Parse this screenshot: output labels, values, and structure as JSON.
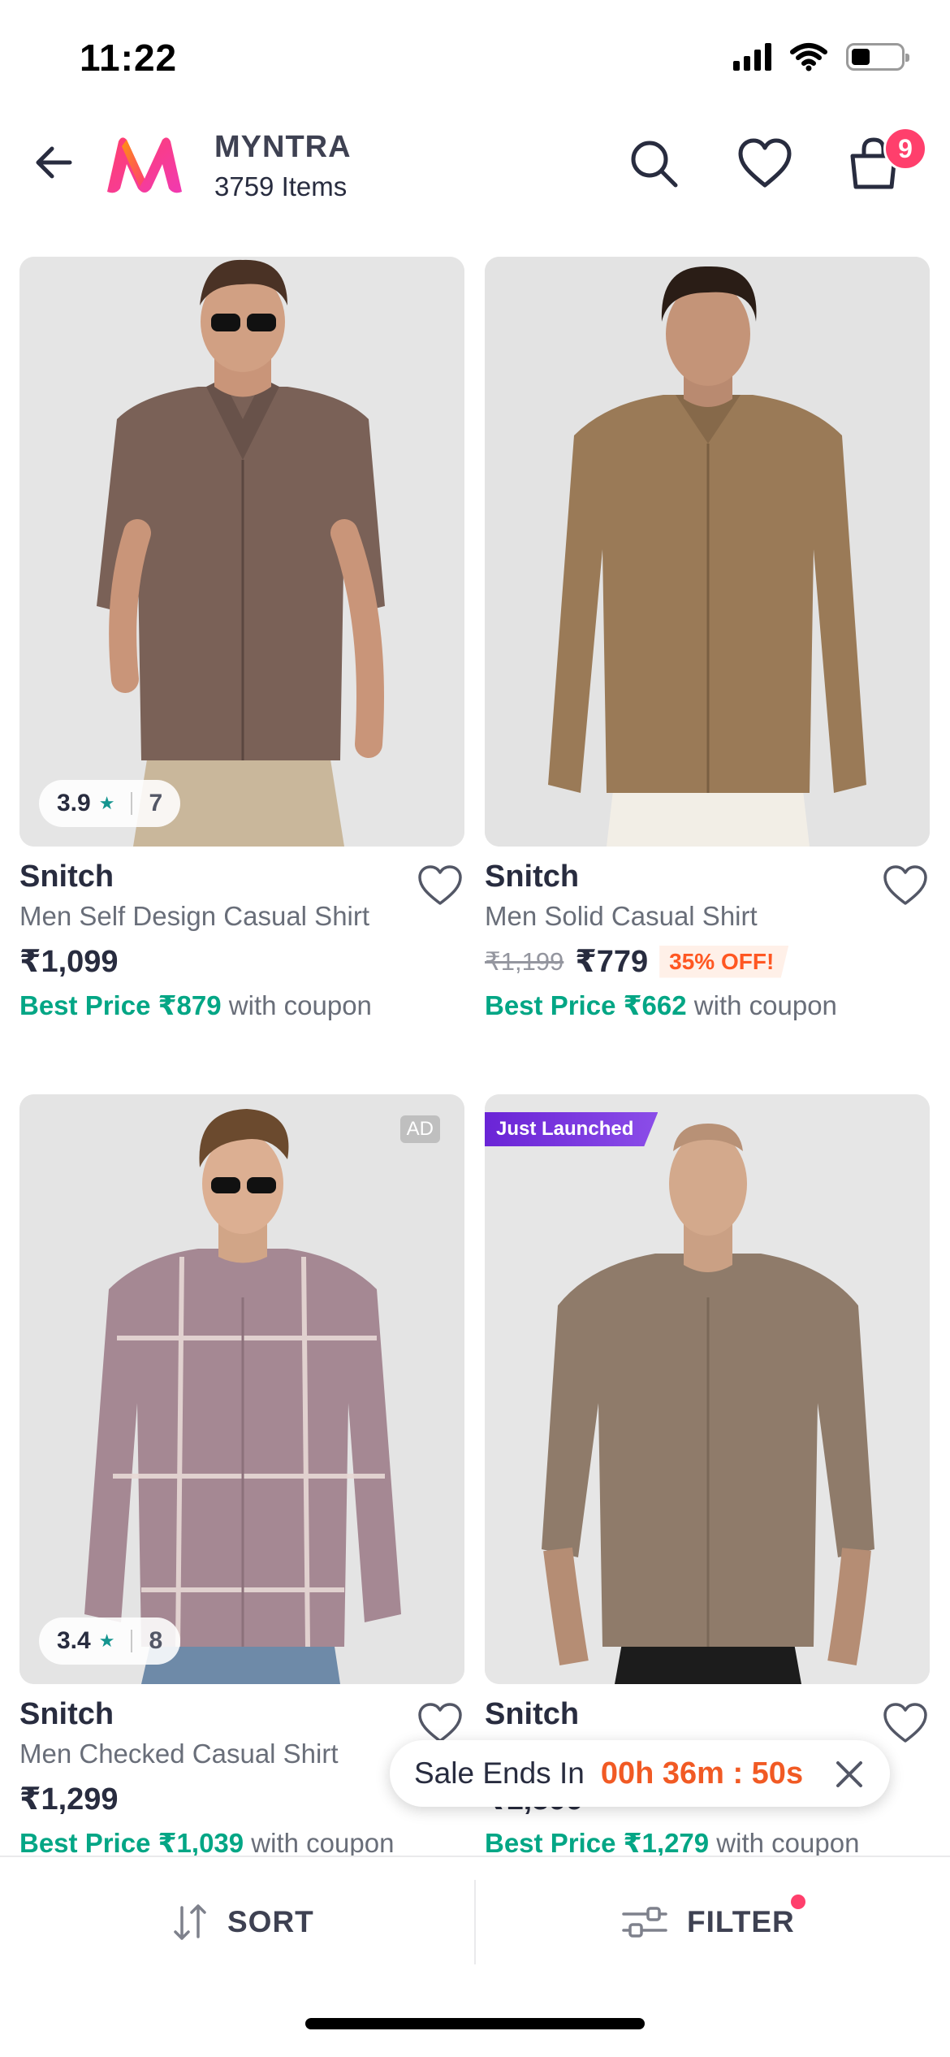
{
  "status_bar": {
    "time": "11:22"
  },
  "header": {
    "brand_title": "MYNTRA",
    "item_count": "3759 Items",
    "bag_count": "9",
    "icons": [
      "back-arrow-icon",
      "myntra-logo",
      "search-icon",
      "heart-icon",
      "bag-icon"
    ]
  },
  "products": [
    {
      "brand": "Snitch",
      "name": "Men Self Design Casual Shirt",
      "price": "₹1,099",
      "best_price_label": "Best Price ₹879",
      "best_price_suffix": " with coupon",
      "rating": "3.9",
      "rating_count": "7"
    },
    {
      "brand": "Snitch",
      "name": "Men Solid Casual Shirt",
      "mrp": "₹1,199",
      "price": "₹779",
      "discount": "35% OFF!",
      "best_price_label": "Best Price ₹662",
      "best_price_suffix": " with coupon"
    },
    {
      "brand": "Snitch",
      "name": "Men Checked Casual Shirt",
      "price": "₹1,299",
      "best_price_label": "Best Price ₹1,039",
      "best_price_suffix": " with coupon",
      "rating": "3.4",
      "rating_count": "8",
      "tag": "AD"
    },
    {
      "brand": "Snitch",
      "price": "₹1,599",
      "best_price_label": "Best Price ₹1,279",
      "best_price_suffix": " with coupon",
      "tag": "Just Launched"
    }
  ],
  "sale_toast": {
    "label": "Sale Ends In",
    "timer": "00h 36m : 50s"
  },
  "bottom_bar": {
    "sort_label": "SORT",
    "filter_label": "FILTER"
  },
  "colors": {
    "accent": "#ff3f6c",
    "best_price": "#03a685",
    "discount": "#ff5722",
    "launch_tag": "#6a24d6"
  }
}
